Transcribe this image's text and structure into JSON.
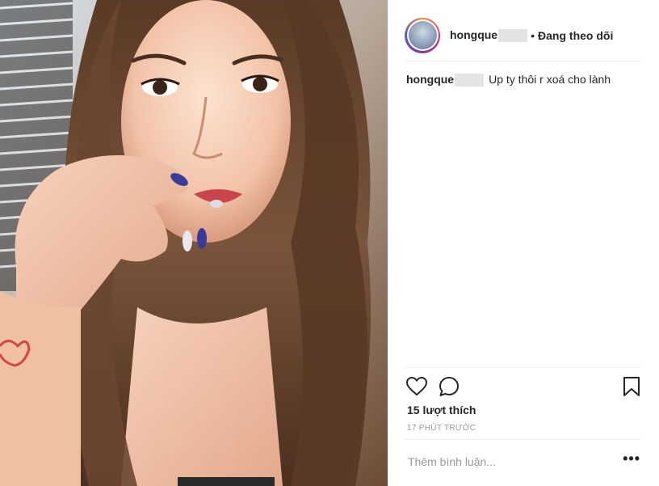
{
  "post": {
    "author": "hongque",
    "separator": "•",
    "follow_status": "Đang theo dõi",
    "caption_user": "hongque",
    "caption_text": "Up ty thôi r xoá cho lành",
    "likes": "15 lượt thích",
    "timestamp": "17 PHÚT TRƯỚC",
    "comment_placeholder": "Thêm bình luận...",
    "more_label": "•••"
  },
  "icons": {
    "like": "heart-icon",
    "comment": "comment-icon",
    "save": "bookmark-icon",
    "options": "more-options-icon"
  },
  "colors": {
    "text": "#262626",
    "muted": "#999999",
    "divider": "#efefef"
  }
}
